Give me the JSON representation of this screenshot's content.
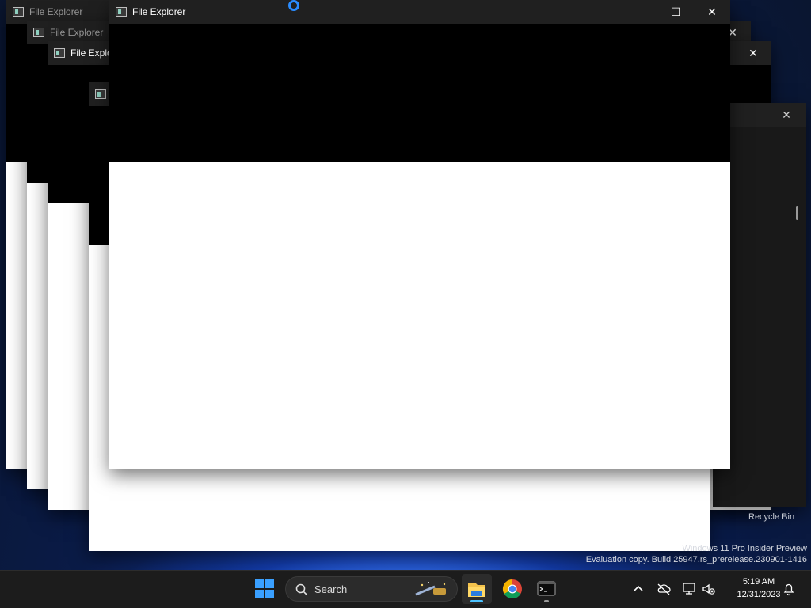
{
  "windows": [
    {
      "title": "File Explorer"
    },
    {
      "title": "File Explorer"
    },
    {
      "title": "File Explorer"
    },
    {
      "title": "File Explorer"
    }
  ],
  "desktop": {
    "recycle_bin_label": "Recycle Bin",
    "watermark_line1": "Windows 11 Pro Insider Preview",
    "watermark_line2": "Evaluation copy. Build 25947.rs_prerelease.230901-1416"
  },
  "taskbar": {
    "search_label": "Search",
    "pinned_apps": [
      "file-explorer",
      "chrome",
      "terminal"
    ],
    "clock_time": "5:19 AM",
    "clock_date": "12/31/2023"
  },
  "colors": {
    "accent": "#4cc2ff",
    "taskbar": "#1c1c1c",
    "titlebar": "#202020"
  }
}
